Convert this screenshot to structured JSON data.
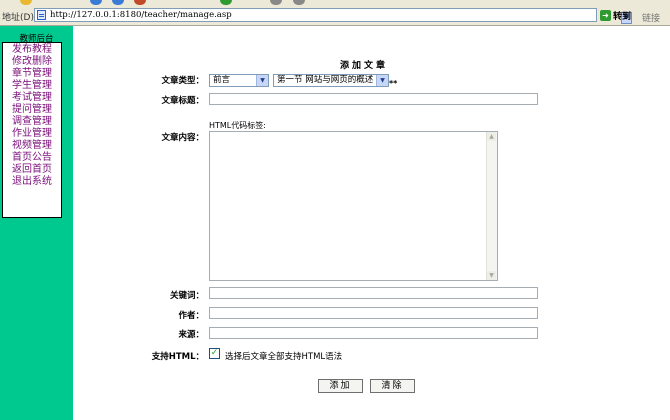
{
  "browser": {
    "address_label": "地址(D)",
    "url": "http://127.0.0.1:8180/teacher/manage.asp",
    "go_label": "转到",
    "links_label": "链接"
  },
  "sidebar": {
    "title": "教师后台",
    "items": [
      {
        "label": "发布教程"
      },
      {
        "label": "修改删除"
      },
      {
        "label": "章节管理"
      },
      {
        "label": "学生管理"
      },
      {
        "label": "考试管理"
      },
      {
        "label": "提问管理"
      },
      {
        "label": "调查管理"
      },
      {
        "label": "作业管理"
      },
      {
        "label": "视频管理"
      },
      {
        "label": "首页公告"
      },
      {
        "label": "返回首页"
      },
      {
        "label": "退出系统"
      }
    ]
  },
  "form": {
    "title": "添加文章",
    "type_label": "文章类型：",
    "type_selected": "前言",
    "section_selected": "第一节  网站与网页的概述",
    "required_mark": "**",
    "title_label": "文章标题：",
    "title_value": "",
    "html_tag_label": "HTML代码标签:",
    "content_label": "文章内容：",
    "content_value": "",
    "keywords_label": "关键词：",
    "keywords_value": "",
    "author_label": "作者：",
    "author_value": "",
    "source_label": "来源：",
    "source_value": "",
    "html_support_label": "支持HTML：",
    "html_support_checked": true,
    "html_support_text": "选择后文章全部支持HTML语法",
    "add_button": "添加",
    "clear_button": "清除"
  }
}
